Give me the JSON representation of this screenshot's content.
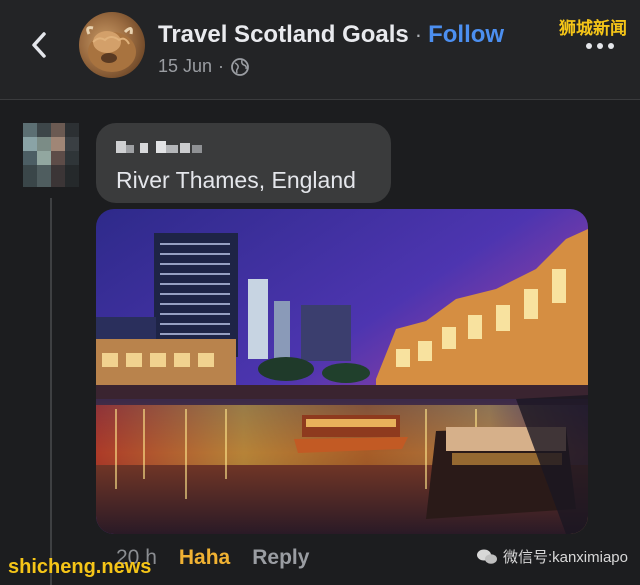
{
  "header": {
    "page_name": "Travel Scotland Goals",
    "separator": "·",
    "follow_label": "Follow",
    "date": "15 Jun",
    "meta_separator": "·",
    "privacy_icon": "globe-icon",
    "back_icon": "chevron-left-icon",
    "more_icon": "more-horizontal-icon",
    "watermark": "狮城新闻"
  },
  "comment": {
    "text": "River Thames, England",
    "reactions": {
      "time": "20 h",
      "haha_label": "Haha",
      "reply_label": "Reply"
    }
  },
  "watermarks": {
    "bottom_left": "shicheng.news",
    "bottom_right": "微信号:kanximiapo"
  },
  "colors": {
    "background": "#1c1d1f",
    "bubble": "#3a3b3c",
    "follow": "#4c8ff0",
    "haha": "#f0b233",
    "watermark": "#f5c518"
  }
}
